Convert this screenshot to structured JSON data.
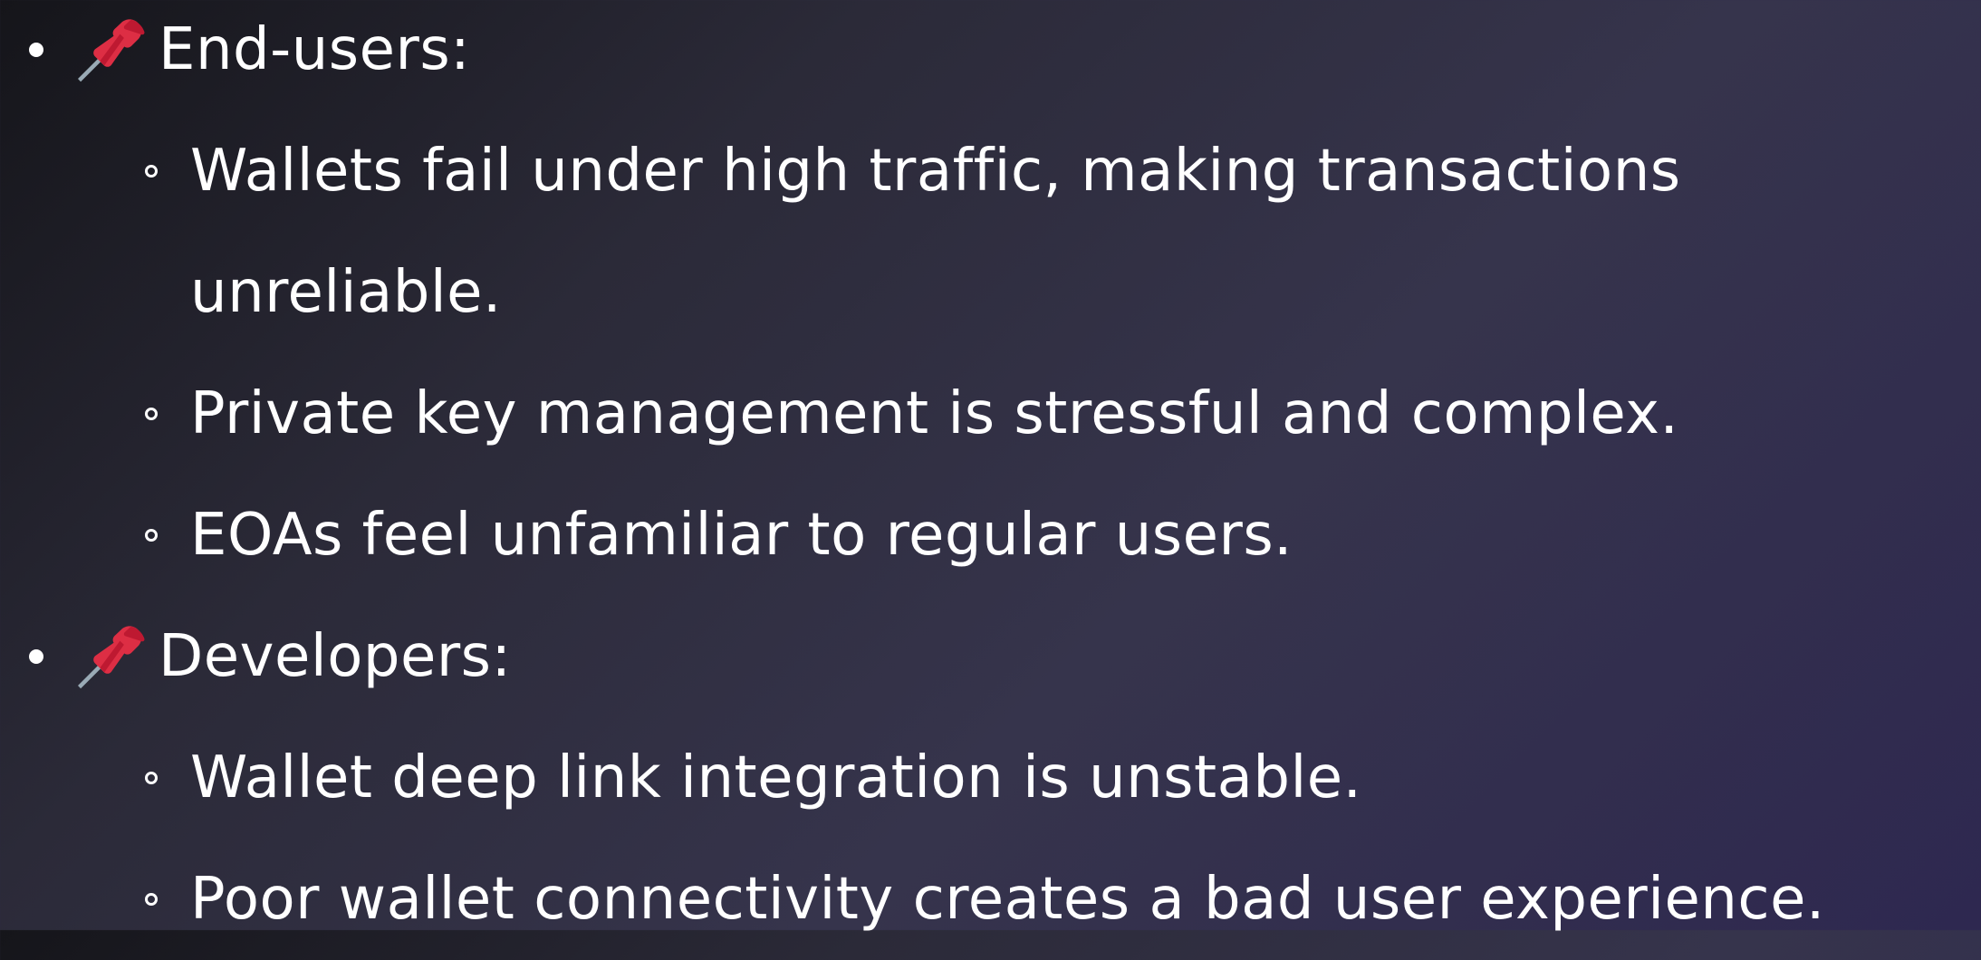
{
  "groups": [
    {
      "icon": "pushpin-icon",
      "heading": "End-users:",
      "items": [
        {
          "line1": "Wallets fail under high traffic, making transactions",
          "line2": "unreliable."
        },
        {
          "line1": "Private key management is stressful and complex."
        },
        {
          "line1": "EOAs feel unfamiliar to regular users."
        }
      ]
    },
    {
      "icon": "pushpin-icon",
      "heading": "Developers:",
      "items": [
        {
          "line1": "Wallet deep link integration is unstable."
        },
        {
          "line1": "Poor wallet connectivity creates a bad user experience."
        }
      ]
    }
  ],
  "colors": {
    "text": "#ffffff",
    "pin_red": "#dd2e44",
    "pin_dark": "#be1931",
    "needle": "#99aab5"
  }
}
